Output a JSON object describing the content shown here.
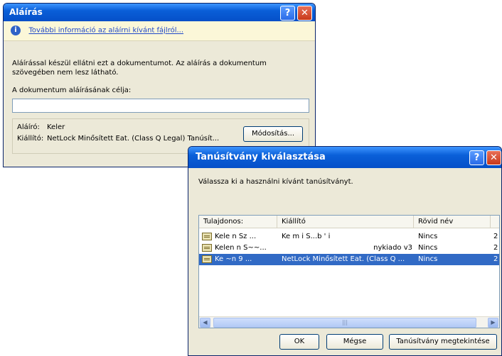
{
  "sign_dialog": {
    "title": "Aláírás",
    "help_glyph": "?",
    "close_glyph": "✕",
    "info_icon_glyph": "i",
    "info_link": "További információ az aláírni kívánt fájlról...",
    "description": "Aláírással készül ellátni ezt a dokumentumot. Az aláírás a dokumentum szövegében nem lesz látható.",
    "purpose_label": "A dokumentum aláírásának célja:",
    "purpose_value": "",
    "signer_label": "Aláíró:",
    "signer_value": "Keler",
    "issuer_label": "Kiállító:",
    "issuer_value": "NetLock Minősített Eat. (Class Q Legal) Tanúsít...",
    "modify_button": "Módosítás..."
  },
  "cert_dialog": {
    "title": "Tanúsítvány kiválasztása",
    "help_glyph": "?",
    "close_glyph": "✕",
    "prompt": "Válassza ki a használni kívánt tanúsítványt.",
    "columns": [
      "Tulajdonos:",
      "Kiállító",
      "Rövid név"
    ],
    "rows": [
      {
        "owner": "Kele   n Sz ...",
        "issuer": "Ke  m   i S...b  '    i",
        "short": "Nincs",
        "extra": "2",
        "selected": false
      },
      {
        "owner": "Kelen  n S~~...",
        "issuer": "nykiado v3",
        "short": "Nincs",
        "extra": "2",
        "selected": false
      },
      {
        "owner": "Ke    ~n 9  ...",
        "issuer": "NetLock Minősített Eat. (Class Q ...",
        "short": "Nincs",
        "extra": "2",
        "selected": true
      }
    ],
    "scroll_left": "◀",
    "scroll_right": "▶",
    "scroll_grip": "|||",
    "ok_button": "OK",
    "cancel_button": "Mégse",
    "view_cert_button": "Tanúsítvány megtekintése"
  },
  "colors": {
    "titlebar_blue": "#0550c8",
    "selection_blue": "#316ac5",
    "dialog_face": "#ece9d8",
    "info_bar": "#fbf7d8",
    "link_blue": "#1f48c8"
  }
}
